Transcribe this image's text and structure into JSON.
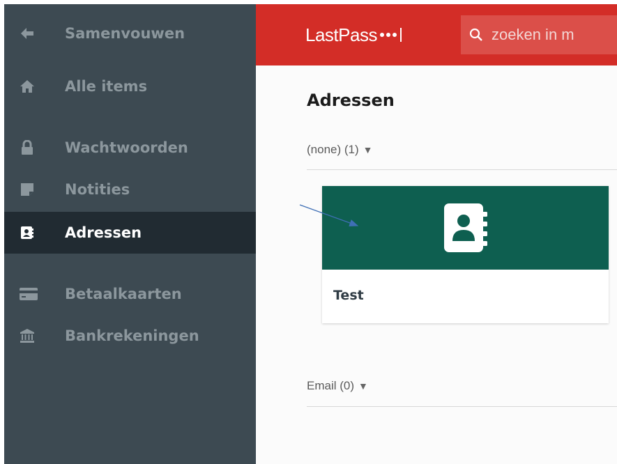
{
  "sidebar": {
    "items": [
      {
        "label": "Samenvouwen",
        "icon": "arrow-left-icon",
        "active": false
      },
      {
        "label": "Alle items",
        "icon": "home-icon",
        "active": false
      },
      {
        "label": "Wachtwoorden",
        "icon": "lock-icon",
        "active": false
      },
      {
        "label": "Notities",
        "icon": "note-icon",
        "active": false
      },
      {
        "label": "Adressen",
        "icon": "address-book-icon",
        "active": true
      },
      {
        "label": "Betaalkaarten",
        "icon": "credit-card-icon",
        "active": false
      },
      {
        "label": "Bankrekeningen",
        "icon": "bank-icon",
        "active": false
      }
    ]
  },
  "header": {
    "logo": "LastPass",
    "search_placeholder": "zoeken in m",
    "brand_color": "#d32d27"
  },
  "main": {
    "title": "Adressen",
    "groups": [
      {
        "label": "(none) (1)",
        "caret": "▼"
      },
      {
        "label": "Email (0)",
        "caret": "▼"
      }
    ],
    "card": {
      "title": "Test",
      "banner_color": "#0e5f50",
      "icon": "address-book-icon"
    }
  }
}
